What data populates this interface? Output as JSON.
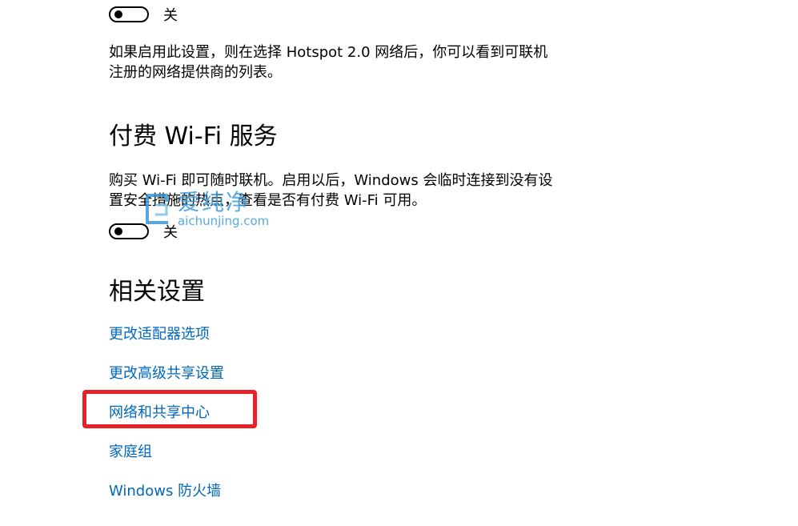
{
  "hotspot_section": {
    "toggle_label": "关",
    "description": "如果启用此设置，则在选择 Hotspot 2.0 网络后，你可以看到可联机注册的网络提供商的列表。"
  },
  "paid_wifi_section": {
    "heading": "付费 Wi-Fi 服务",
    "description": "购买 Wi-Fi 即可随时联机。启用以后，Windows 会临时连接到没有设置安全措施的热点，查看是否有付费 Wi-Fi 可用。",
    "toggle_label": "关"
  },
  "related_settings": {
    "heading": "相关设置",
    "links": [
      "更改适配器选项",
      "更改高级共享设置",
      "网络和共享中心",
      "家庭组",
      "Windows 防火墙"
    ]
  },
  "highlight": {
    "target": "网络和共享中心",
    "color": "#e8202a"
  },
  "watermark": {
    "text_cn": "爱纯净",
    "text_en": "aichunjing.com",
    "color": "#3a9ad9"
  },
  "colors": {
    "link": "#0067c0",
    "text": "#000000",
    "background": "#ffffff"
  }
}
